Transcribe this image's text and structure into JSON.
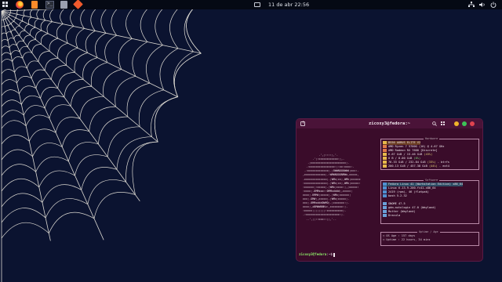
{
  "topbar": {
    "clock": "11 de abr  22:56",
    "apps": [
      "activities-icon",
      "firefox-icon",
      "files-icon",
      "terminal-icon",
      "software-store-icon",
      "git-icon"
    ],
    "tray": [
      "network-icon",
      "sound-icon",
      "power-icon"
    ]
  },
  "terminal": {
    "title": "zicoxy3@fedora:~",
    "ascii_art": [
      "          .',;::::;,'.",
      "      .';:cccccccccccc:;,.",
      "   .;cccccccccccccccccccccc;.",
      "  .:cccccccccccccccc:;:cc:cccc:.",
      " .:ccccccccccccc;.;0WWNOO0WWd;ccc:.",
      ",ccccccccccccc;.:WMWNOOONMWo,ccccc,",
      ".cccccccccccccc;.;WMx;cc;,WMk;cccccc",
      ":cccccccccccccc;.;WMx;cc;,WMk;ccccc:",
      ":cccccc;:ccccc;.;WMx;cccc:;,;ccccc:",
      ":cccc;.0MMxoo::0MMxdddd;,ccccc;",
      "cccc;.KMMd;ccccc;.;WMx;cccccc;",
      "ccc;.OMW;,ccccc;.;WMx;ccccc;.",
      "ccc;.0MMxddd0WMO;.;ccccccc:;.",
      "cccc;,xNMWWNNKx:,cccccccc:;.",
      ":ccccc;;;;;;;;:cccccccccc;.",
      ".:ccccccccccccccccccccc:;.",
      "  ..',;;::ccc::;;,'.."
    ],
    "hardware_title": "Hardware",
    "hardware": [
      {
        "label": "PC",
        "value": "B550 AORUS ELITE V2"
      },
      {
        "label": "CPU",
        "value": "AMD Ryzen 7 5700G (16) @ 4.67 GHz"
      },
      {
        "label": "GPU",
        "value": "AMD Radeon RX 7600 [Discrete]"
      },
      {
        "label": "RAM",
        "value": "6.67 GiB / 15.46 GiB",
        "pct": "(43%)"
      },
      {
        "label": "SWAP",
        "value": "0 B / 8.00 GiB",
        "pct": "(0%)"
      },
      {
        "label": "DISK",
        "value": "76.33 GiB / 232.84 GiB",
        "pct": "(33%)",
        "suffix": "- btrfs"
      },
      {
        "label": "DISK",
        "value": "200.13 GiB / 457.38 GiB",
        "pct": "(44%)",
        "suffix": "- ext4"
      }
    ],
    "software_title": "Software",
    "software": [
      {
        "label": "OS",
        "value": "Fedora Linux 41 (Workstation Edition) x86_64"
      },
      {
        "label": "KER",
        "value": "Linux 6.13.9-200.fc41.x86_64"
      },
      {
        "label": "PKG",
        "value": "2419 (rpm), 46 (flatpak)"
      },
      {
        "label": "SH",
        "value": "bash 5.2.32"
      },
      {
        "label": "DE",
        "value": "GNOME 47.5"
      },
      {
        "label": "LM",
        "value": "gdm-autologin 47.0 (Wayland)"
      },
      {
        "label": "WM",
        "value": "Mutter (Wayland)"
      },
      {
        "label": "TH",
        "value": "Dracula"
      }
    ],
    "uptime_title": "Uptime / Age",
    "uptime": [
      {
        "label": "OS Age",
        "value": "157 days"
      },
      {
        "label": "Uptime",
        "value": "22 hours, 34 mins"
      }
    ],
    "prompt_user": "zicoxy3@fedora",
    "prompt_path": ":~$"
  },
  "colors": {
    "desktop_bg": "#0b1330",
    "terminal_bg": "#3a0c2a",
    "prompt_green": "#8ef06a"
  }
}
